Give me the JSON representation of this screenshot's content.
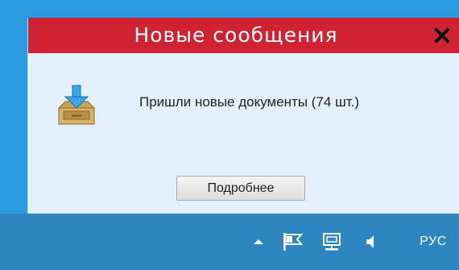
{
  "notification": {
    "title": "Новые сообщения",
    "message": "Пришли новые документы (74 шт.)",
    "button_label": "Подробнее",
    "icon": "inbox-download-icon",
    "close_icon": "close-icon"
  },
  "taskbar": {
    "tray_icons": [
      "chevron-up-icon",
      "flag-icon",
      "network-icon",
      "volume-icon"
    ],
    "language": "РУС"
  },
  "colors": {
    "title_bar": "#cf2233",
    "popup_background": "#e2f1fb",
    "taskbar": "#2d86bf"
  }
}
